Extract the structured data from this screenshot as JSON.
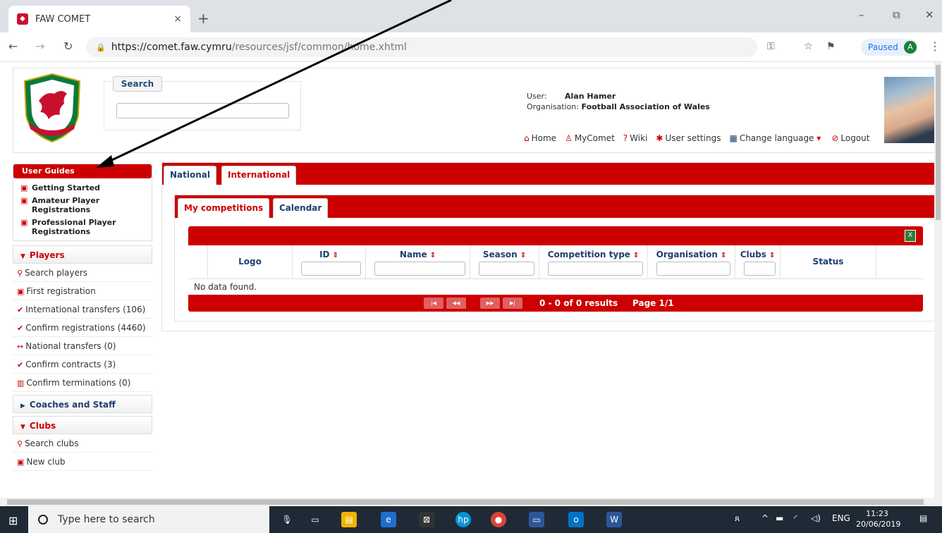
{
  "browser": {
    "tab_title": "FAW COMET",
    "tab_close": "×",
    "new_tab": "+",
    "url_host": "https://comet.faw.cymru",
    "url_path": "/resources/jsf/common/home.xhtml",
    "profile_label": "Paused",
    "profile_initial": "A",
    "window_min": "–",
    "window_restore": "⧉",
    "window_close": "✕"
  },
  "header": {
    "search_label": "Search",
    "search_value": "",
    "user_label": "User:",
    "user_name": "Alan Hamer",
    "org_label": "Organisation:",
    "org_name": "Football Association of Wales",
    "links": {
      "home": "Home",
      "mycomet": "MyComet",
      "wiki": "Wiki",
      "user_settings": "User settings",
      "change_language": "Change language",
      "logout": "Logout"
    }
  },
  "sidebar": {
    "user_guides": {
      "title": "User Guides",
      "items": [
        "Getting Started",
        "Amateur Player Registrations",
        "Professional Player Registrations"
      ]
    },
    "players": {
      "title": "Players",
      "items": [
        "Search players",
        "First registration",
        "International transfers (106)",
        "Confirm registrations (4460)",
        "National transfers (0)",
        "Confirm contracts (3)",
        "Confirm terminations (0)"
      ]
    },
    "coaches": {
      "title": "Coaches and Staff"
    },
    "clubs": {
      "title": "Clubs",
      "items": [
        "Search clubs",
        "New club"
      ]
    }
  },
  "main": {
    "tabs": [
      "National",
      "International"
    ],
    "subtabs": [
      "My competitions",
      "Calendar"
    ],
    "columns": [
      "Logo",
      "ID",
      "Name",
      "Season",
      "Competition type",
      "Organisation",
      "Clubs",
      "Status"
    ],
    "empty_text": "No data found.",
    "pager_results": "0 - 0 of 0 results",
    "pager_page": "Page 1/1"
  },
  "taskbar": {
    "search_placeholder": "Type here to search",
    "lang": "ENG",
    "time": "11:23",
    "date": "20/06/2019"
  },
  "colors": {
    "brand_red": "#cc0000",
    "navy": "#1f3f6f"
  }
}
